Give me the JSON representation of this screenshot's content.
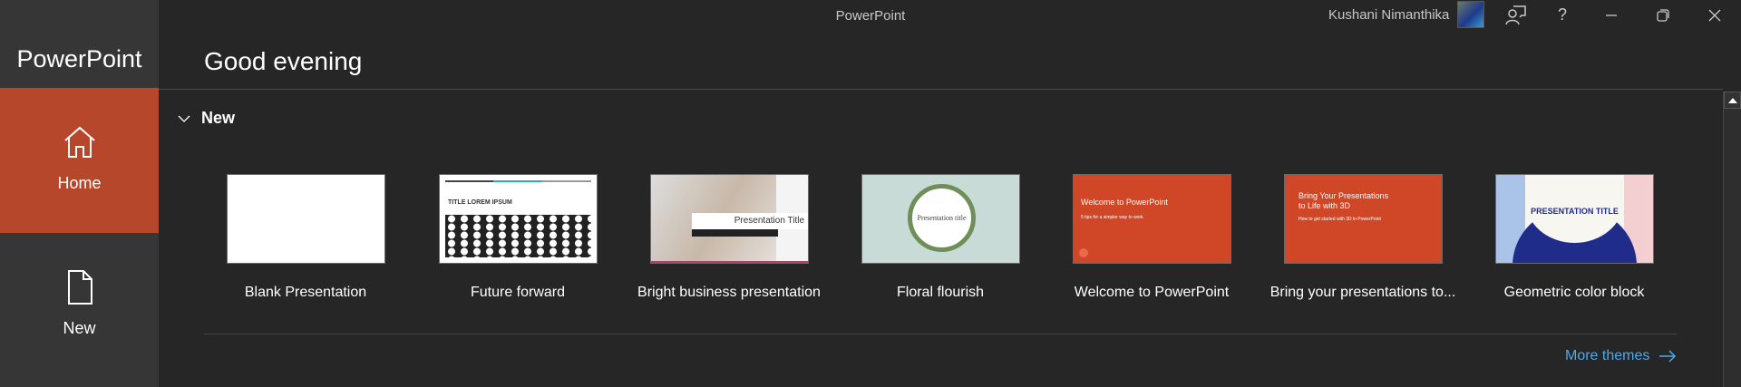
{
  "window": {
    "title": "PowerPoint",
    "user": "Kushani Nimanthika"
  },
  "sidebar": {
    "app_name": "PowerPoint",
    "items": [
      {
        "label": "Home"
      },
      {
        "label": "New"
      }
    ]
  },
  "header": {
    "greeting": "Good evening"
  },
  "section": {
    "title": "New"
  },
  "templates": [
    {
      "label": "Blank Presentation"
    },
    {
      "label": "Future forward",
      "thumb_title": "TITLE LOREM IPSUM"
    },
    {
      "label": "Bright business presentation",
      "thumb_title": "Presentation Title"
    },
    {
      "label": "Floral flourish",
      "thumb_title": "Presentation title"
    },
    {
      "label": "Welcome to PowerPoint",
      "thumb_title": "Welcome to PowerPoint",
      "thumb_sub": "5 tips for a simpler way to work"
    },
    {
      "label": "Bring your presentations to...",
      "thumb_title": "Bring Your Presentations to Life with 3D",
      "thumb_sub": "How to get started with 3D in PowerPoint"
    },
    {
      "label": "Geometric color block",
      "thumb_title": "PRESENTATION TITLE"
    }
  ],
  "more_themes": "More themes",
  "colors": {
    "accent": "#b7472a",
    "link": "#4fa8e8"
  }
}
